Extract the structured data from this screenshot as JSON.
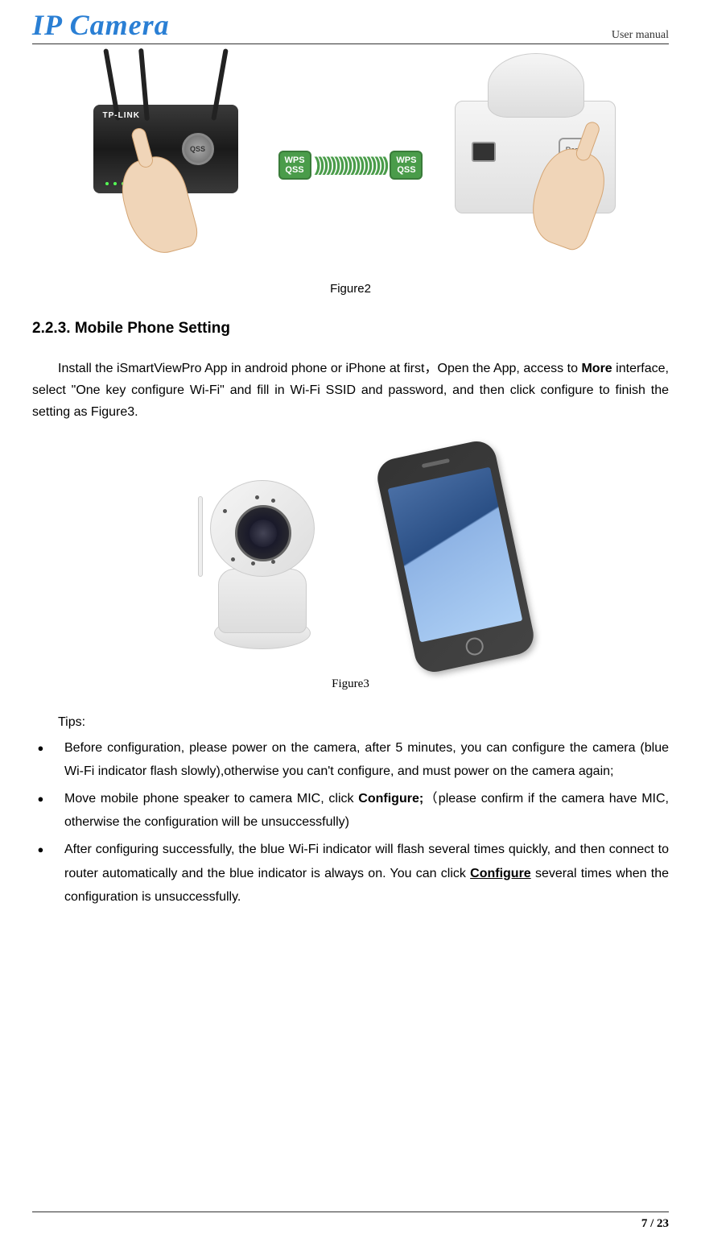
{
  "header": {
    "logo": "IP Camera",
    "doc_label": "User manual"
  },
  "figure2": {
    "caption": "Figure2",
    "router_brand": "TP-LINK",
    "qss_label": "QSS",
    "reset_label": "Reset",
    "wps_badge": "WPS\nQSS"
  },
  "section": {
    "heading": "2.2.3.  Mobile Phone Setting",
    "para1_prefix": "Install the iSmartViewPro App in android phone or iPhone at first，Open the App, access to ",
    "para1_bold": "More",
    "para1_suffix": " interface, select \"One key configure Wi-Fi\" and fill in Wi-Fi SSID and password, and then click configure to finish the setting as Figure3."
  },
  "figure3": {
    "caption": "Figure3"
  },
  "tips": {
    "label": "Tips:",
    "items": [
      {
        "text": "Before configuration, please power on the camera, after 5 minutes, you can configure the camera (blue Wi-Fi indicator flash slowly),otherwise you can't configure, and must power on the camera again;"
      },
      {
        "prefix": "Move mobile phone speaker to camera MIC, click ",
        "bold": "Configure;",
        "suffix": "（please confirm if the camera have MIC, otherwise the configuration will be unsuccessfully)"
      },
      {
        "prefix": "After configuring successfully, the blue Wi-Fi indicator will flash several times quickly, and then connect to router automatically and the blue indicator is always on. You can click ",
        "bold_underline": "Configure",
        "suffix": " several times when the configuration is unsuccessfully."
      }
    ]
  },
  "footer": {
    "page": "7 / 23"
  }
}
